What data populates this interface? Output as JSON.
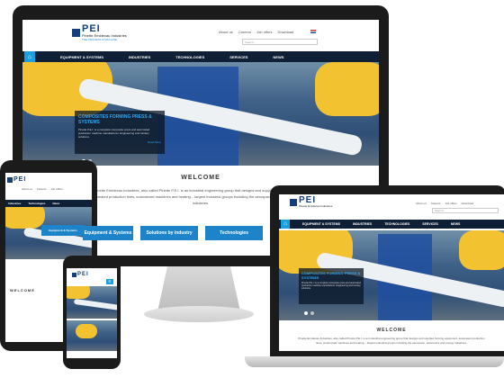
{
  "brand": {
    "logo_text": "PEI",
    "company": "Pinette Emidecau Industries",
    "tagline": "THE PROCESS & MACHINE"
  },
  "toplinks": [
    "About us",
    "Careers",
    "Job offers",
    "Download"
  ],
  "search_placeholder": "Search...",
  "nav": [
    "EQUIPMENT & SYSTEMS",
    "INDUSTRIES",
    "TECHNOLOGIES",
    "SERVICES",
    "NEWS"
  ],
  "tablet_nav": [
    "Industries",
    "Technologies",
    "News"
  ],
  "hero": {
    "title": "COMPOSITES FORMING PRESS & SYSTEMS",
    "body": "Pinette P.E.I. is a complete composite press and automated production machine manufacturer. Engineering and turnkey solutions.",
    "more": "Read More"
  },
  "welcome": "WELCOME",
  "welcome_text": "Pinette Emidecau Industries, also called Pinette P.E.I. is an industrial engineering group that designs and supplies forming equipment, automated production lines, customized machines and heating... largest industrial groups including the aerospace, automotive and energy industries.",
  "buttons": [
    "Equipment & Systems",
    "Solutions by industry",
    "Technologies"
  ],
  "colors": {
    "nav": "#0f1f35",
    "accent": "#1a9fe0",
    "brand": "#143f7a",
    "button": "#1d84c9"
  }
}
